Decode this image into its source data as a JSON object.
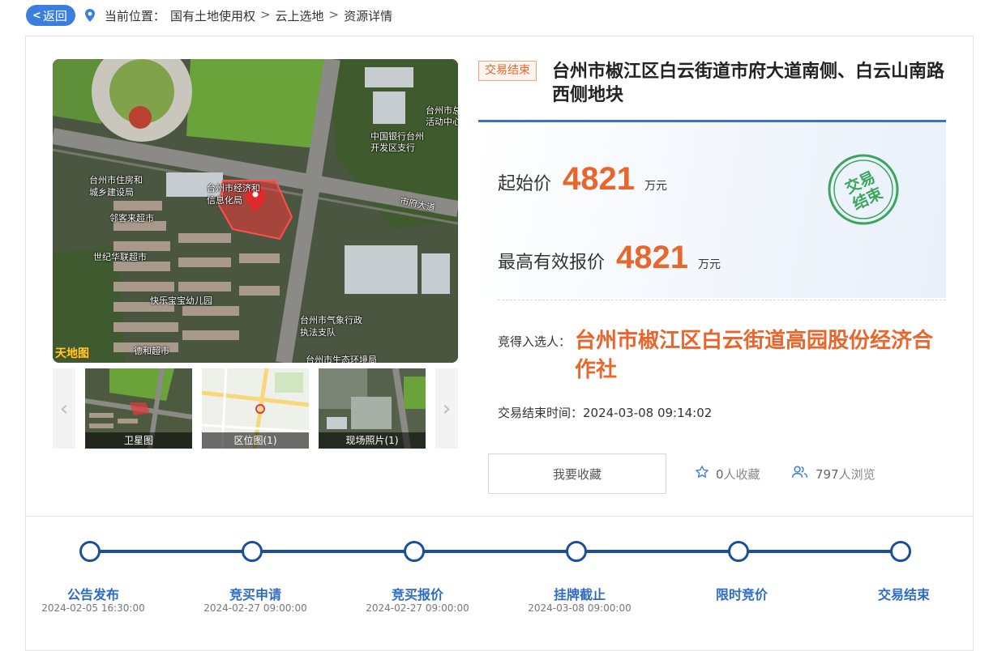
{
  "nav": {
    "back_label": "返回",
    "location_prefix": "当前位置：",
    "crumbs": [
      "国有土地使用权",
      "云上选地",
      "资源详情"
    ],
    "separator": ">"
  },
  "map": {
    "labels": [
      "台州市住房和",
      "城乡建设局",
      "台州市经济和",
      "信息化局",
      "邻客来超市",
      "世纪华联超市",
      "快乐宝宝幼儿园",
      "德和超市",
      "台州市气象行政",
      "执法支队",
      "台州市生态环境局",
      "中国银行台州",
      "开发区支行",
      "台州市总",
      "活动中心",
      "市府大道"
    ],
    "watermark": "天地图"
  },
  "thumbnails": [
    {
      "caption": "卫星图"
    },
    {
      "caption": "区位图(1)"
    },
    {
      "caption": "现场照片(1)"
    }
  ],
  "listing": {
    "status": "交易结束",
    "title": "台州市椒江区白云街道市府大道南侧、白云山南路西侧地块",
    "start_price_label": "起始价",
    "start_price": "4821",
    "start_price_unit": "万元",
    "top_bid_label": "最高有效报价",
    "top_bid": "4821",
    "top_bid_unit": "万元",
    "stamp_line1": "交易",
    "stamp_line2": "结束",
    "winner_label": "竞得入选人：",
    "winner": "台州市椒江区白云街道高园股份经济合作社",
    "end_time_label": "交易结束时间：",
    "end_time": "2024-03-08 09:14:02",
    "favorite_button": "我要收藏",
    "favorites_count": "0",
    "favorites_suffix": "人收藏",
    "views_count": "797",
    "views_suffix": "人浏览"
  },
  "timeline": [
    {
      "label": "公告发布",
      "date": "2024-02-05 16:30:00"
    },
    {
      "label": "竞买申请",
      "date": "2024-02-27 09:00:00"
    },
    {
      "label": "竞买报价",
      "date": "2024-02-27 09:00:00"
    },
    {
      "label": "挂牌截止",
      "date": "2024-03-08 09:00:00"
    },
    {
      "label": "限时竞价",
      "date": ""
    },
    {
      "label": "交易结束",
      "date": ""
    }
  ],
  "colors": {
    "accent_blue": "#3a7fe0",
    "timeline_blue": "#1b4f9b",
    "price_orange": "#e8662c",
    "stamp_green": "#3ba55c"
  }
}
